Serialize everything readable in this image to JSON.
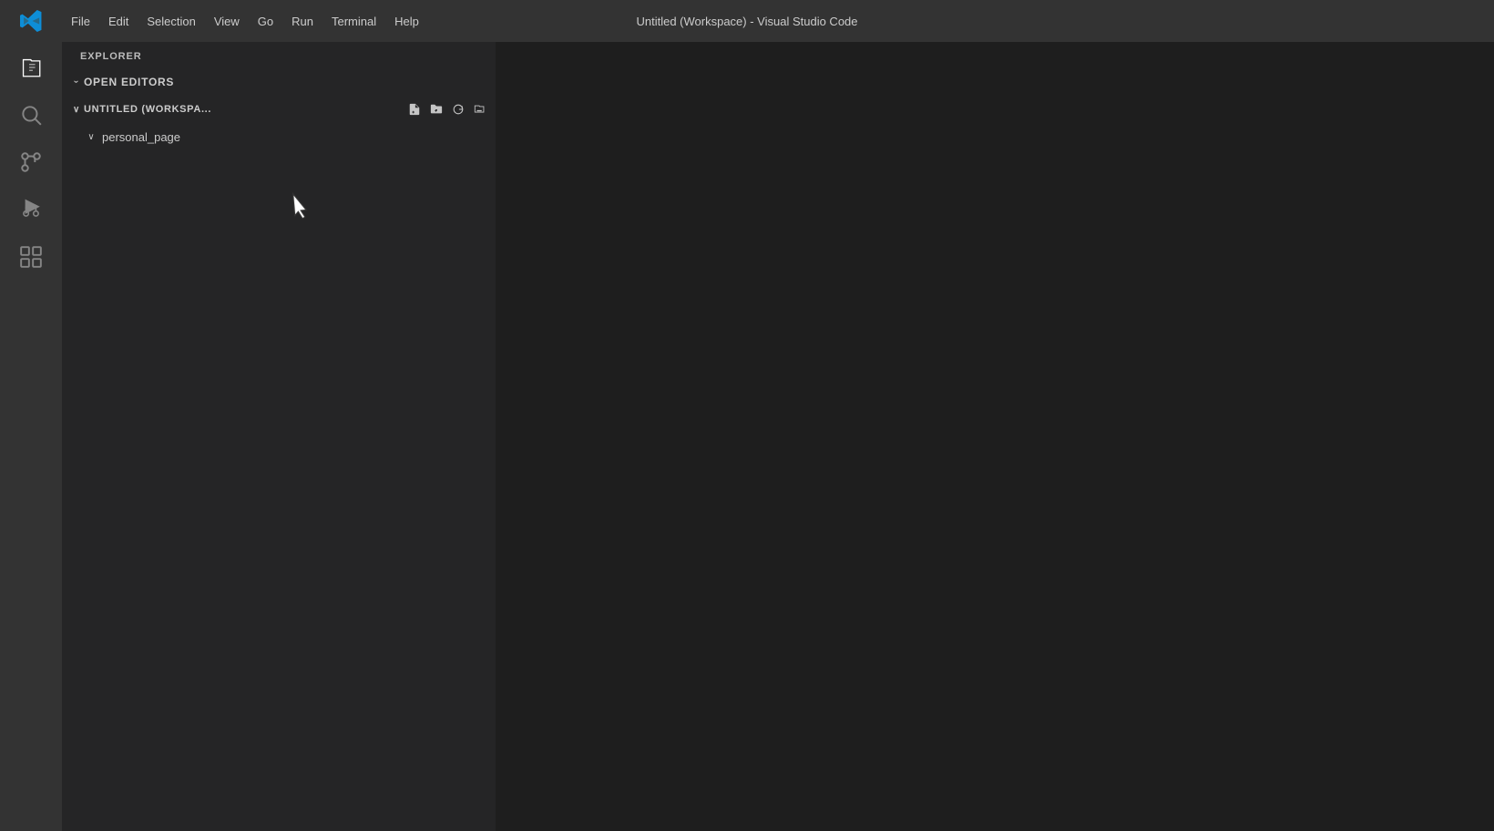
{
  "titlebar": {
    "window_title": "Untitled (Workspace) - Visual Studio Code",
    "menu_items": [
      {
        "id": "file",
        "label": "File"
      },
      {
        "id": "edit",
        "label": "Edit"
      },
      {
        "id": "selection",
        "label": "Selection"
      },
      {
        "id": "view",
        "label": "View"
      },
      {
        "id": "go",
        "label": "Go"
      },
      {
        "id": "run",
        "label": "Run"
      },
      {
        "id": "terminal",
        "label": "Terminal"
      },
      {
        "id": "help",
        "label": "Help"
      }
    ]
  },
  "activity_bar": {
    "items": [
      {
        "id": "explorer",
        "label": "Explorer",
        "icon": "files-icon",
        "active": true
      },
      {
        "id": "search",
        "label": "Search",
        "icon": "search-icon",
        "active": false
      },
      {
        "id": "source-control",
        "label": "Source Control",
        "icon": "source-control-icon",
        "active": false
      },
      {
        "id": "run-debug",
        "label": "Run and Debug",
        "icon": "run-debug-icon",
        "active": false
      },
      {
        "id": "extensions",
        "label": "Extensions",
        "icon": "extensions-icon",
        "active": false
      }
    ]
  },
  "sidebar": {
    "header": "EXPLORER",
    "open_editors": {
      "label": "OPEN EDITORS",
      "expanded": false
    },
    "workspace": {
      "label": "UNTITLED (WORKSPA...",
      "expanded": true,
      "actions": [
        {
          "id": "new-file",
          "label": "New File",
          "icon": "new-file-icon"
        },
        {
          "id": "new-folder",
          "label": "New Folder",
          "icon": "new-folder-icon"
        },
        {
          "id": "refresh",
          "label": "Refresh Explorer",
          "icon": "refresh-icon"
        },
        {
          "id": "collapse",
          "label": "Collapse Folders in Explorer",
          "icon": "collapse-icon"
        }
      ],
      "items": [
        {
          "id": "personal-page",
          "label": "personal_page",
          "type": "folder",
          "expanded": false
        }
      ]
    }
  }
}
